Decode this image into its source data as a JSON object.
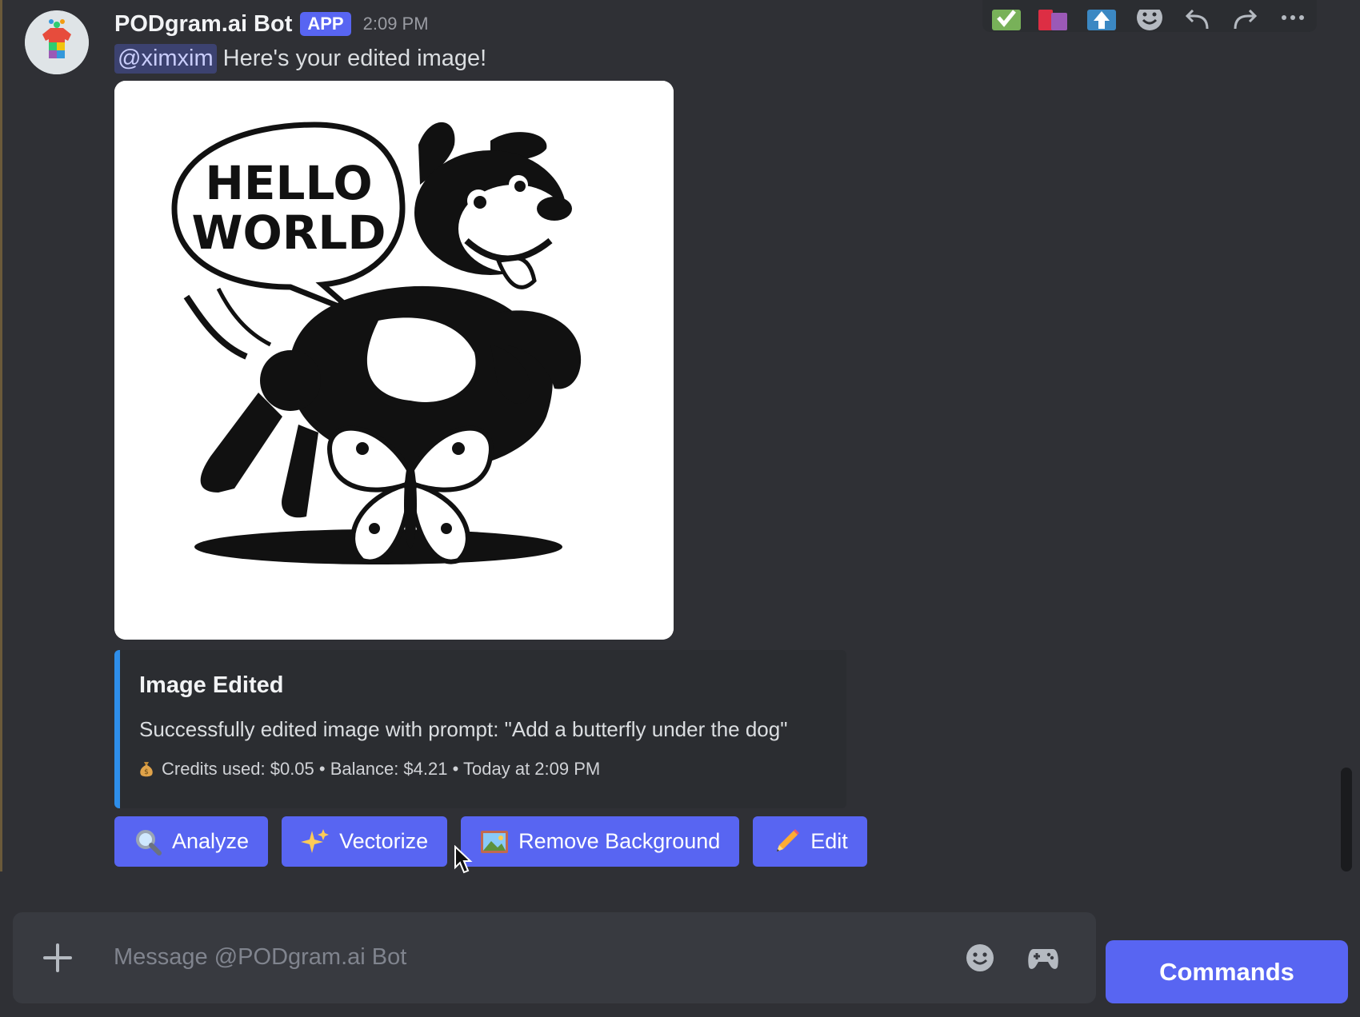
{
  "message": {
    "author": "PODgram.ai Bot",
    "badge": "APP",
    "time": "2:09 PM",
    "mention": "@ximxim",
    "text": "Here's your edited image!",
    "image_text_line1": "HELLO",
    "image_text_line2": "WORLD"
  },
  "embed": {
    "title": "Image Edited",
    "description": "Successfully edited image with prompt: \"Add a butterfly under the dog\"",
    "footer": "Credits used: $0.05 • Balance: $4.21 • Today at 2:09 PM"
  },
  "buttons": [
    {
      "label": "Analyze",
      "icon": "magnifier-icon"
    },
    {
      "label": "Vectorize",
      "icon": "sparkles-icon"
    },
    {
      "label": "Remove Background",
      "icon": "picture-icon"
    },
    {
      "label": "Edit",
      "icon": "pencil-icon"
    }
  ],
  "toolbar": [
    "check-reaction-icon",
    "book-reaction-icon",
    "upload-reaction-icon",
    "add-reaction-icon",
    "reply-icon",
    "forward-icon",
    "more-icon"
  ],
  "composer": {
    "placeholder": "Message @PODgram.ai Bot",
    "commands_label": "Commands"
  },
  "colors": {
    "background": "#2f3035",
    "blurple": "#5865f2",
    "embed_accent": "#2e8eea"
  }
}
